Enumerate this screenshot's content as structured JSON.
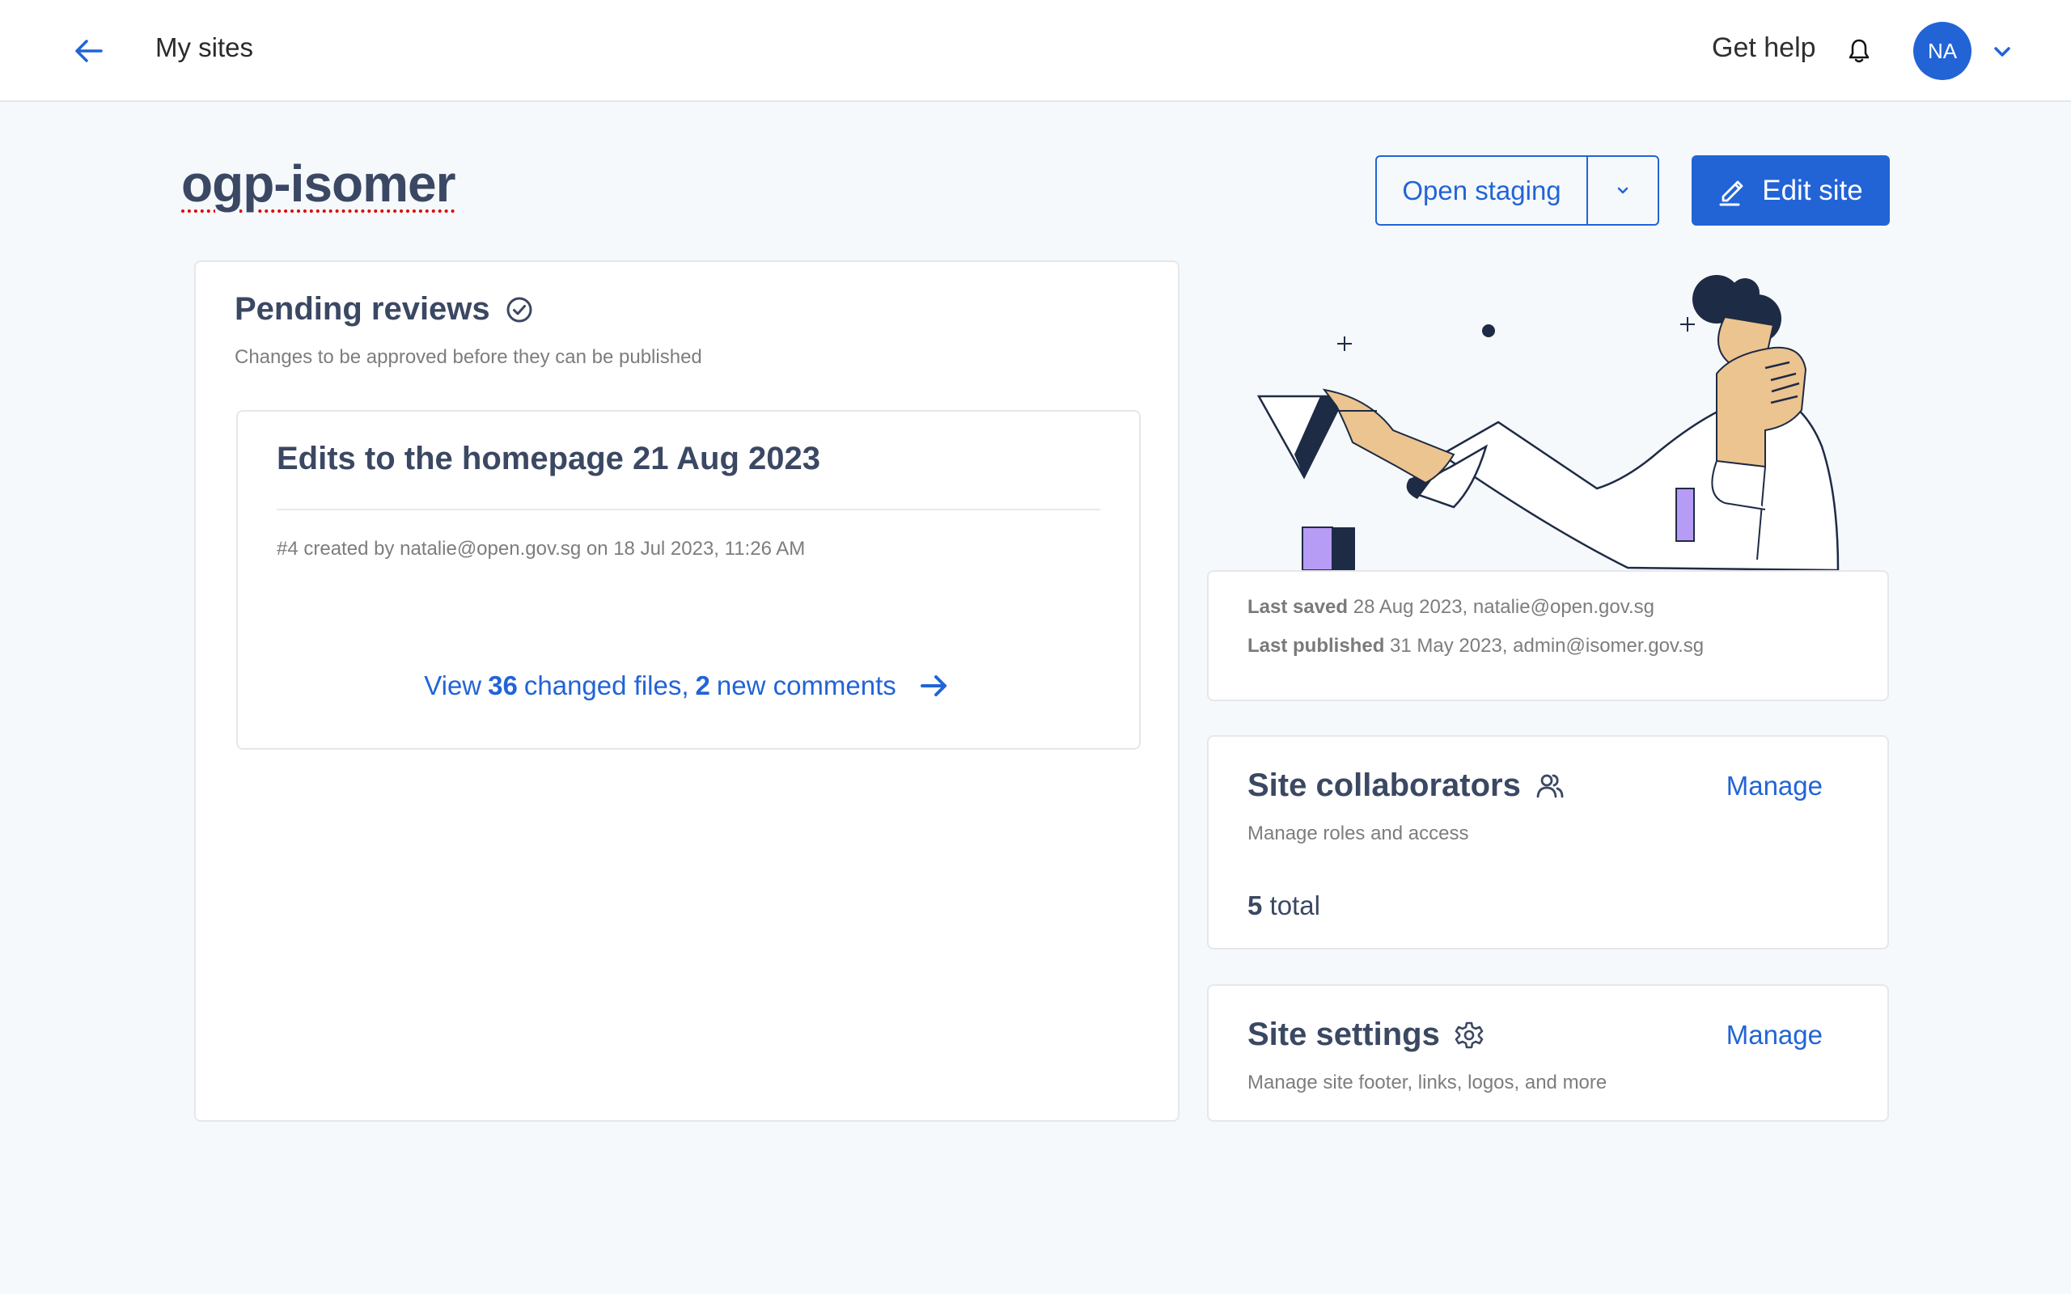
{
  "header": {
    "back_label": "My sites",
    "get_help": "Get help",
    "avatar_initials": "NA"
  },
  "site": {
    "name": "ogp-isomer"
  },
  "actions": {
    "open_staging": "Open staging",
    "edit_site": "Edit site"
  },
  "pending_reviews": {
    "title": "Pending reviews",
    "subtitle": "Changes to be approved before they can be published",
    "items": [
      {
        "title": "Edits to the homepage 21 Aug 2023",
        "meta": "#4 created by natalie@open.gov.sg on 18 Jul 2023, 11:26 AM",
        "link_prefix": "View",
        "changed_files": "36",
        "files_label": "changed files,",
        "new_comments": "2",
        "comments_label": "new comments"
      }
    ]
  },
  "site_info": {
    "last_saved_label": "Last saved",
    "last_saved_value": "28 Aug 2023, natalie@open.gov.sg",
    "last_published_label": "Last published",
    "last_published_value": "31 May 2023, admin@isomer.gov.sg"
  },
  "collaborators": {
    "title": "Site collaborators",
    "manage": "Manage",
    "subtitle": "Manage roles and access",
    "total_count": "5",
    "total_label": "total"
  },
  "settings": {
    "title": "Site settings",
    "manage": "Manage",
    "subtitle": "Manage site footer, links, logos, and more"
  },
  "colors": {
    "primary": "#2264d6",
    "heading": "#3b4863",
    "muted": "#7d7d7d",
    "background": "#f6f9fc",
    "illustration_navy": "#1e2b45",
    "illustration_skin": "#ecc490",
    "illustration_purple": "#b79cf5"
  }
}
